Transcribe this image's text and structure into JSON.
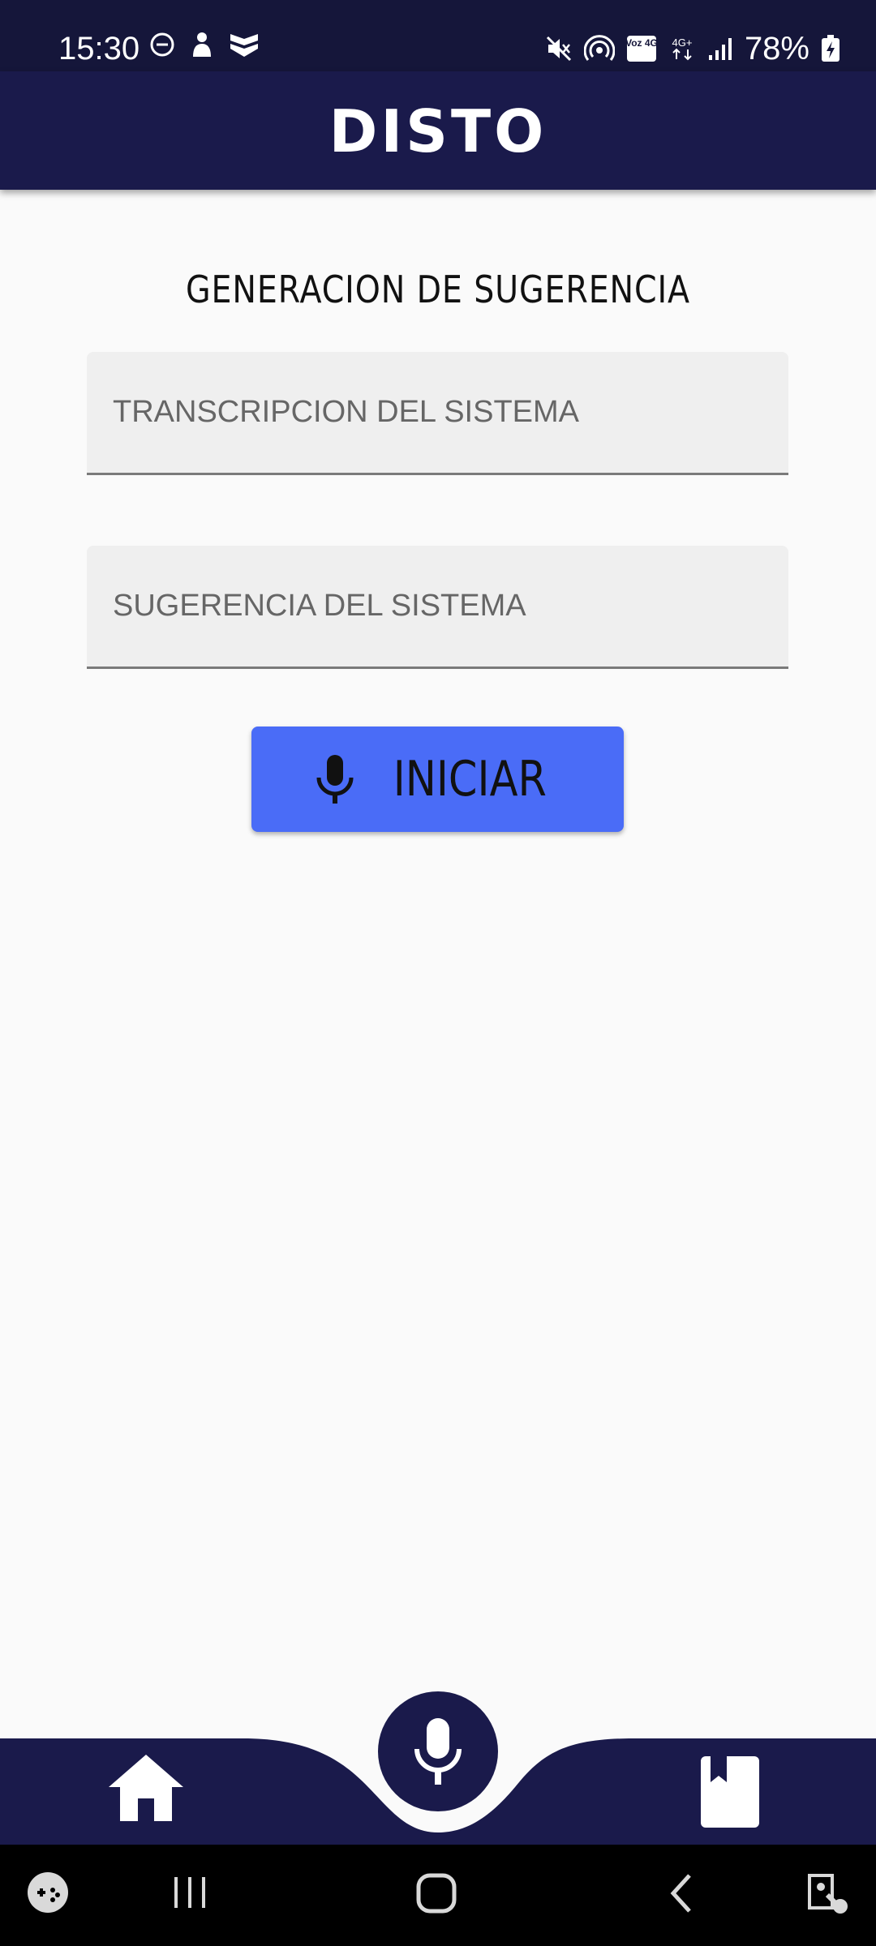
{
  "status_bar": {
    "time": "15:30",
    "battery_percent": "78%",
    "icons_left": [
      "dnd-icon",
      "person-icon",
      "shield-icon"
    ],
    "icons_right": [
      "mute-icon",
      "hotspot-icon",
      "volte-icon",
      "4g-icon",
      "signal-icon",
      "battery-charging-icon"
    ],
    "volte_label": "Voz 4G",
    "network_label": "4G+"
  },
  "app_bar": {
    "title": "DISTO"
  },
  "main": {
    "section_title": "GENERACION DE SUGERENCIA",
    "transcription_field": {
      "placeholder": "TRANSCRIPCION DEL SISTEMA",
      "value": ""
    },
    "suggestion_field": {
      "placeholder": "SUGERENCIA DEL SISTEMA",
      "value": ""
    },
    "start_button": {
      "label": "INICIAR",
      "icon": "microphone-icon"
    }
  },
  "bottom_nav": {
    "items": [
      "home-icon",
      "microphone-icon",
      "book-icon"
    ]
  },
  "system_nav": [
    "game-launcher-icon",
    "recents-icon",
    "home-icon",
    "back-icon",
    "accessibility-icon"
  ],
  "colors": {
    "status_bar_bg": "#15163a",
    "app_bar_bg": "#1a1a4b",
    "button_bg": "#4a6cf7",
    "background": "#fafafa"
  }
}
